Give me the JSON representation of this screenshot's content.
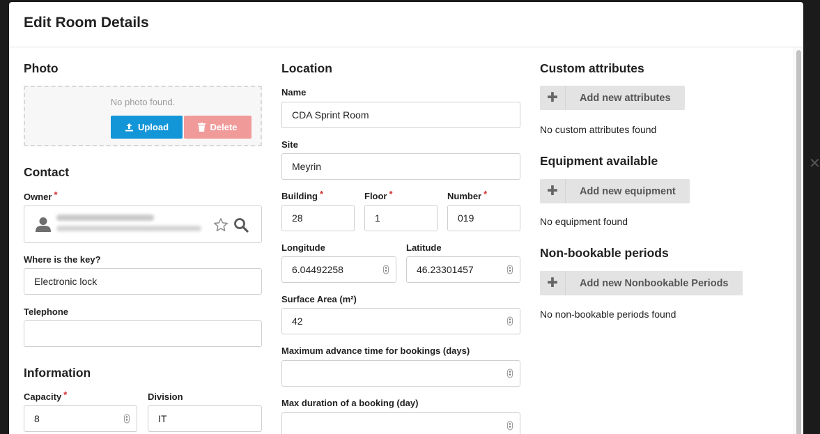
{
  "dialog": {
    "title": "Edit Room Details",
    "close_icon": "close-icon"
  },
  "photo": {
    "section_title": "Photo",
    "empty_message": "No photo found.",
    "upload_label": "Upload",
    "delete_label": "Delete"
  },
  "contact": {
    "section_title": "Contact",
    "owner_label": "Owner",
    "key_label": "Where is the key?",
    "key_value": "Electronic lock",
    "telephone_label": "Telephone",
    "telephone_value": ""
  },
  "information": {
    "section_title": "Information",
    "capacity_label": "Capacity",
    "capacity_value": "8",
    "division_label": "Division",
    "division_value": "IT"
  },
  "location": {
    "section_title": "Location",
    "name_label": "Name",
    "name_value": "CDA Sprint Room",
    "site_label": "Site",
    "site_value": "Meyrin",
    "building_label": "Building",
    "building_value": "28",
    "floor_label": "Floor",
    "floor_value": "1",
    "number_label": "Number",
    "number_value": "019",
    "longitude_label": "Longitude",
    "longitude_value": "6.04492258",
    "latitude_label": "Latitude",
    "latitude_value": "46.23301457",
    "surface_label": "Surface Area (m²)",
    "surface_value": "42",
    "max_advance_label": "Maximum advance time for bookings (days)",
    "max_advance_value": "",
    "max_duration_label": "Max duration of a booking (day)",
    "max_duration_value": ""
  },
  "custom_attributes": {
    "section_title": "Custom attributes",
    "add_label": "Add new attributes",
    "empty_message": "No custom attributes found"
  },
  "equipment": {
    "section_title": "Equipment available",
    "add_label": "Add new equipment",
    "empty_message": "No equipment found"
  },
  "nonbookable": {
    "section_title": "Non-bookable periods",
    "add_label": "Add new Nonbookable Periods",
    "empty_message": "No non-bookable periods found"
  },
  "required_marker": "*"
}
